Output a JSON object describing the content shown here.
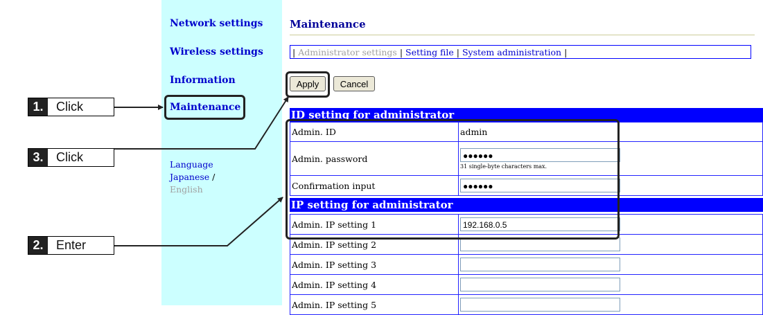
{
  "sidebar": {
    "items": [
      {
        "label": "Network settings"
      },
      {
        "label": "Wireless settings"
      },
      {
        "label": "Information"
      },
      {
        "label": "Maintenance"
      }
    ],
    "language_label": "Language",
    "language_japanese": "Japanese",
    "language_separator": " /",
    "language_english": "English"
  },
  "main": {
    "title": "Maintenance",
    "linkbar": {
      "sep": "|",
      "items": [
        "Administrator settings",
        "Setting file",
        "System administration"
      ]
    },
    "apply_label": "Apply",
    "cancel_label": "Cancel",
    "id_section": {
      "title": "ID setting for administrator",
      "admin_id_label": "Admin. ID",
      "admin_id_value": "admin",
      "password_label": "Admin. password",
      "password_value": "●●●●●●",
      "password_hint": "31 single-byte characters max.",
      "confirm_label": "Confirmation input",
      "confirm_value": "●●●●●●"
    },
    "ip_section": {
      "title": "IP setting for administrator",
      "rows": [
        {
          "label": "Admin. IP setting 1",
          "value": "192.168.0.5"
        },
        {
          "label": "Admin. IP setting 2",
          "value": ""
        },
        {
          "label": "Admin. IP setting 3",
          "value": ""
        },
        {
          "label": "Admin. IP setting 4",
          "value": ""
        },
        {
          "label": "Admin. IP setting 5",
          "value": ""
        }
      ]
    }
  },
  "callouts": [
    {
      "num": "1.",
      "text": "Click"
    },
    {
      "num": "3.",
      "text": "Click"
    },
    {
      "num": "2.",
      "text": "Enter"
    }
  ],
  "colors": {
    "sidebar_bg": "#ccffff",
    "section_bg": "#0000ff",
    "link": "#0000cc",
    "title": "#000099"
  }
}
